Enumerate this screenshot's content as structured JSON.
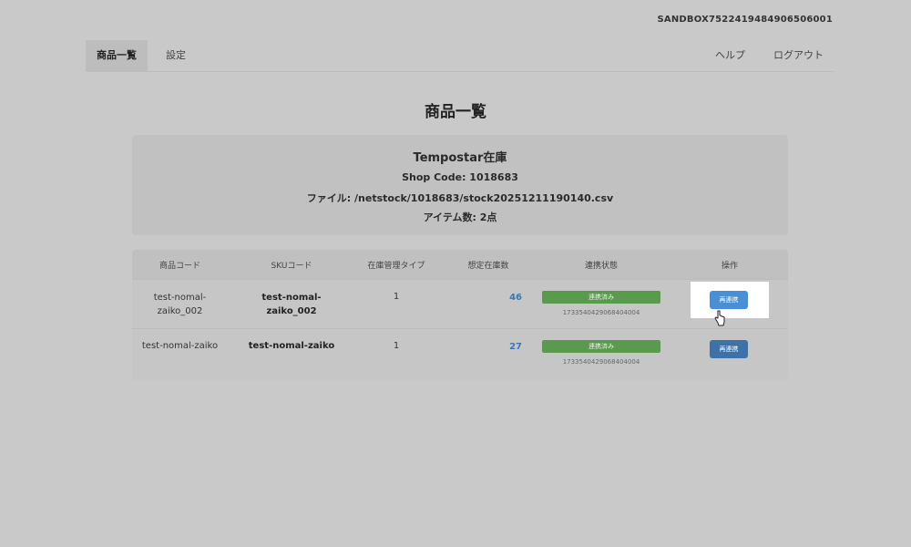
{
  "header": {
    "shop_id": "SANDBOX7522419484906506001"
  },
  "nav": {
    "tabs": [
      {
        "label": "商品一覧",
        "active": true
      },
      {
        "label": "設定",
        "active": false
      }
    ],
    "help_label": "ヘルプ",
    "logout_label": "ログアウト"
  },
  "page_title": "商品一覧",
  "info": {
    "title": "Tempostar在庫",
    "shop_code": "Shop Code: 1018683",
    "file": "ファイル: /netstock/1018683/stock20251211190140.csv",
    "items": "アイテム数: 2点"
  },
  "table": {
    "headers": [
      "商品コード",
      "SKUコード",
      "在庫管理タイプ",
      "想定在庫数",
      "連携状態",
      "操作"
    ],
    "rows": [
      {
        "product_code": [
          "test-nomal-",
          "zaiko_002"
        ],
        "sku_code": [
          "test-nomal-",
          "zaiko_002"
        ],
        "type": "1",
        "qty": "46",
        "status": "連携済み",
        "status_id": "1733540429068404004",
        "action": "再連携"
      },
      {
        "product_code": [
          "test-nomal-zaiko"
        ],
        "sku_code": [
          "test-nomal-zaiko"
        ],
        "type": "1",
        "qty": "27",
        "status": "連携済み",
        "status_id": "1733540429068404004",
        "action": "再連携"
      }
    ]
  },
  "colors": {
    "badge_green": "#5a9a4e",
    "button_blue": "#4a8fd6",
    "qty_blue": "#3a78b5"
  },
  "icons": {
    "cursor": "hand-pointer-icon"
  }
}
